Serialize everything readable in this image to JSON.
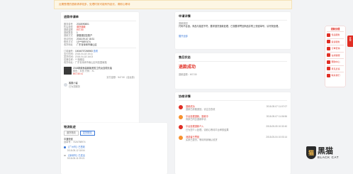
{
  "notice": {
    "text": "近期受理的退款请求较多，处理时效可能有所延长，请耐心等待"
  },
  "order": {
    "title": "退款申请单",
    "rows": [
      {
        "k": "服务单号",
        "v": "2018090801"
      },
      {
        "k": "售后类型",
        "v": "退货退款"
      },
      {
        "k": "退款金额",
        "v": "¥47.50"
      },
      {
        "k": "退款数量",
        "v": "1"
      },
      {
        "k": "退款方式",
        "v": "原路退回至账户"
      },
      {
        "k": "申请时间",
        "v": "2018-09-10 18:31"
      },
      {
        "k": "联系方式",
        "v": "13***5897474"
      },
      {
        "k": "收货地址",
        "v": "广东省深圳市南山区"
      }
    ],
    "order_no_label": "订单编号：",
    "order_no": "10046757265983",
    "detail_link": "查看",
    "pay_time": "支付时间：2018-04-18 15:11",
    "deliver_time": "发货时间：2018-04-18 16:03",
    "shop": "店铺名称：***旗舰店",
    "address": "收货地址：广东省深圳市南山区科技园南路",
    "product_name": "2018新款秋装韩版宽松卫衣女连帽长袖",
    "product_spec": "颜色：灰色  尺码：XL",
    "product_price": "¥47.50 x1",
    "product_total": "实付金额：¥47.50（含运费）",
    "cs_label": "客服小蜜",
    "cs_status": "已为您服务"
  },
  "logistics": {
    "title": "物流轨迹",
    "tabs": [
      "退货物流",
      "发货物流"
    ],
    "company": "中通快递",
    "waybill": "运单号：7326758974",
    "events": [
      {
        "text": "【广州市】已签收",
        "time": "2018-05-12 18:54"
      },
      {
        "text": "【深圳市】已发出",
        "time": "2018-05-11 09:21"
      }
    ]
  },
  "refund": {
    "title": "申请详情",
    "reason_label": "退款原因",
    "reason": "尺码不合适，商品与描述不符，要求退货退款处理，已按要求寄回商品并附上快递单号，请尽快处理。",
    "more_link": "展开全部"
  },
  "status": {
    "title": "售后状态",
    "value": "退款成功",
    "amount": "退款金额：¥47.50"
  },
  "history": {
    "title": "协商详情",
    "items": [
      {
        "who": "退款成功",
        "time": "2018-05-07 11:07:07",
        "desc": "退款已原路退回，请注意查收"
      },
      {
        "who": "平台处理退款，退款中",
        "time": "2018-05-07 11:06:56",
        "desc": "商家已同意退款申请"
      },
      {
        "who": "平台处理退款介入",
        "time": "2018-05-05 10:32:40",
        "desc": "已为您介入处理，请耐心等待平台审核结果"
      },
      {
        "who": "消费者已寄回",
        "time": "2018-05-04 10:03:14",
        "desc": "买家已退货，等待商家确认收货"
      }
    ]
  },
  "side_menu": {
    "header": "退款处理",
    "items": [
      "售后服务",
      "投诉服务",
      "订单查询",
      "在线客服",
      "帮助中心",
      "意见反馈",
      "联系我们"
    ],
    "tab_label": "客服"
  },
  "watermark": {
    "mark": "猫",
    "text": "黑猫",
    "sub": "BLACK CAT"
  },
  "colors": {
    "accent": "#e02e24",
    "link": "#3a78d8",
    "notice_bg": "#fdf6e4"
  }
}
